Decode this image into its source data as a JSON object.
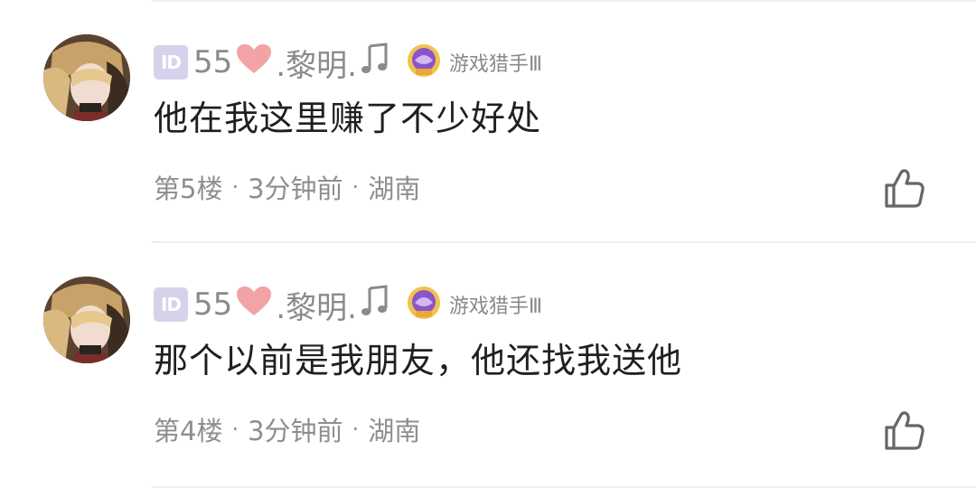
{
  "comments": [
    {
      "id_badge": "ID",
      "username_prefix": "55",
      "username_suffix": ".黎明.",
      "title": "游戏猎手Ⅲ",
      "text": "他在我这里赚了不少好处",
      "floor": "第5楼",
      "time": "3分钟前",
      "location": "湖南",
      "separator": "·"
    },
    {
      "id_badge": "ID",
      "username_prefix": "55",
      "username_suffix": ".黎明.",
      "title": "游戏猎手Ⅲ",
      "text": "那个以前是我朋友，他还找我送他",
      "floor": "第4楼",
      "time": "3分钟前",
      "location": "湖南",
      "separator": "·"
    }
  ],
  "colors": {
    "meta": "#8e8e8e",
    "heart": "#f2a3a6",
    "badge": "#d7d2ec",
    "medal_gold": "#f0c34e",
    "medal_purple": "#8a55c9"
  },
  "icons": [
    "avatar",
    "id-badge",
    "heart-icon",
    "music-note-icon",
    "medal-icon",
    "thumbs-up-icon"
  ]
}
